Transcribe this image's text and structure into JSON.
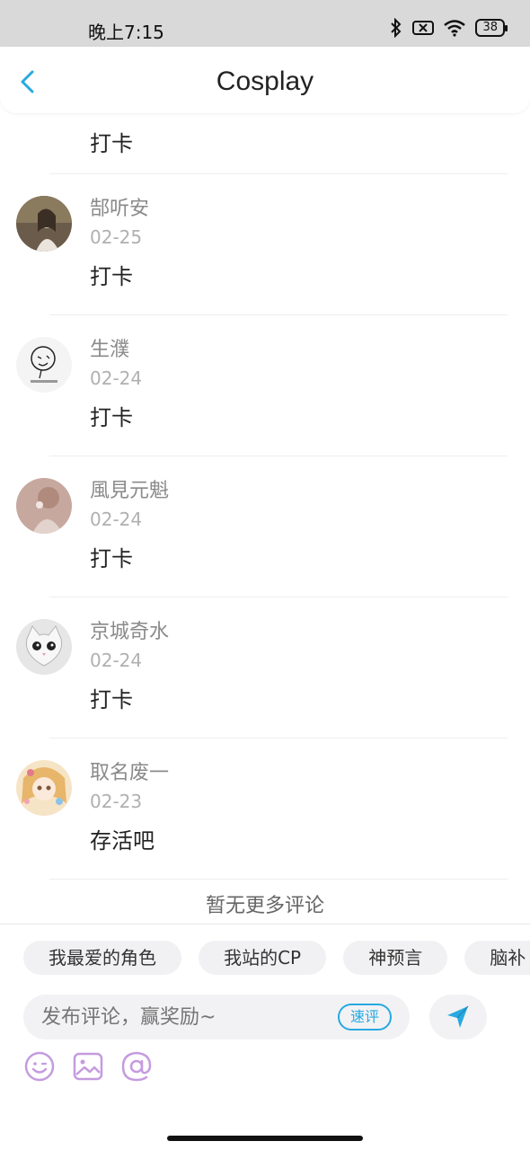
{
  "status_bar": {
    "time": "晚上7:15",
    "battery": "38"
  },
  "header": {
    "title": "Cosplay"
  },
  "partial_comment": {
    "content": "打卡"
  },
  "comments": [
    {
      "name": "郜听安",
      "date": "02-25",
      "content": "打卡",
      "avatar_color": "#6b5b4b"
    },
    {
      "name": "生濮",
      "date": "02-24",
      "content": "打卡",
      "avatar_color": "#f2f2f2"
    },
    {
      "name": "風見元魁",
      "date": "02-24",
      "content": "打卡",
      "avatar_color": "#c7a89f"
    },
    {
      "name": "京城奇水",
      "date": "02-24",
      "content": "打卡",
      "avatar_color": "#d8d8d8"
    },
    {
      "name": "取名废一",
      "date": "02-23",
      "content": "存活吧",
      "avatar_color": "#f3d7a6"
    }
  ],
  "no_more": "暂无更多评论",
  "composer": {
    "chips": [
      "我最爱的角色",
      "我站的CP",
      "神预言",
      "脑补"
    ],
    "input_placeholder": "发布评论，赢奖励~",
    "quick_label": "速评"
  },
  "colors": {
    "accent": "#27a9e1",
    "tool_icon": "#c59be0"
  }
}
